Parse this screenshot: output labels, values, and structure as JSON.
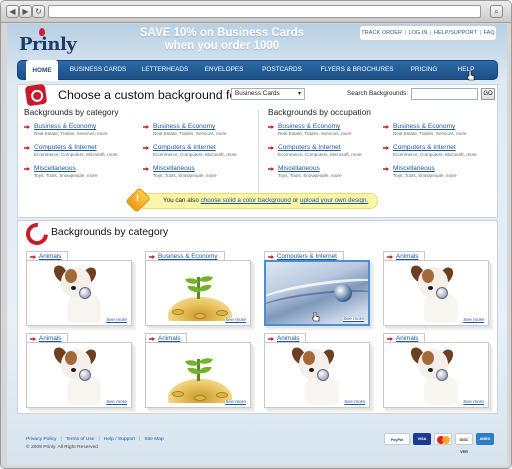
{
  "browser": {
    "back_icon": "back-arrow-icon",
    "forward_icon": "forward-arrow-icon",
    "refresh_icon": "refresh-icon",
    "search_icon": "search-icon"
  },
  "header": {
    "logo_text": "Prinly",
    "promo_line1": "SAVE 10% on Business Cards",
    "promo_line2": "when you order 1000",
    "top_links": [
      "TRACK ORDER",
      "LOG IN",
      "HELP/SUPPORT",
      "FAQ"
    ]
  },
  "nav": {
    "items": [
      "HOME",
      "BUSINESS CARDS",
      "LETTERHEADS",
      "ENVELOPES",
      "POSTCARDS",
      "FLYERS & BROCHURES",
      "PRICING",
      "HELP"
    ],
    "active": "HOME"
  },
  "custom_panel": {
    "title": "Choose a custom background for",
    "select_value": "Business Cards",
    "search_label": "Search Backgrounds:",
    "search_value": "",
    "go_label": "GO",
    "left_heading": "Backgrounds by category",
    "right_heading": "Backgrounds by occupation",
    "left_categories": [
      {
        "label": "Business & Economy",
        "sub": "Real Estate, Trades, Services, more"
      },
      {
        "label": "Business & Economy",
        "sub": "Real Estate, Trades, Services, more"
      },
      {
        "label": "Computers & Internet",
        "sub": "Ecommerce, Computers, Microsoft, more"
      },
      {
        "label": "Computers & Internet",
        "sub": "Ecommerce, Computers, Microsoft, more"
      },
      {
        "label": "Miscellaneous",
        "sub": "Toys, Tools, Snowpeople, more"
      },
      {
        "label": "Miscellaneous",
        "sub": "Toys, Tools, Snowpeople, more"
      }
    ],
    "right_categories": [
      {
        "label": "Business & Economy",
        "sub": "Real Estate, Trades, Services, more"
      },
      {
        "label": "Business & Economy",
        "sub": "Real Estate, Trades, Services, more"
      },
      {
        "label": "Computers & Internet",
        "sub": "Ecommerce, Computers, Microsoft, more"
      },
      {
        "label": "Computers & Internet",
        "sub": "Ecommerce, Computers, Microsoft, more"
      },
      {
        "label": "Miscellaneous",
        "sub": "Toys, Tools, Snowpeople, more"
      },
      {
        "label": "Miscellaneous",
        "sub": "Toys, Tools, Snowpeople, more"
      }
    ],
    "notice_prefix": "You can also",
    "notice_link1": "choose solid a color background",
    "notice_mid": "or",
    "notice_link2": "upload your own design.",
    "notice_icon_text": "i"
  },
  "gallery": {
    "title": "Backgrounds by category",
    "cards": [
      {
        "label": "Animals",
        "image": "dog",
        "see_more": "See more"
      },
      {
        "label": "Business & Economy",
        "image": "coins",
        "see_more": "See more"
      },
      {
        "label": "Computers & Internet",
        "image": "tech",
        "see_more": "See more"
      },
      {
        "label": "Animals",
        "image": "dog",
        "see_more": "See more"
      },
      {
        "label": "Animals",
        "image": "dog",
        "see_more": "See more"
      },
      {
        "label": "Animals",
        "image": "coins",
        "see_more": "See more"
      },
      {
        "label": "Animals",
        "image": "dog",
        "see_more": "See more"
      },
      {
        "label": "Animals",
        "image": "dog",
        "see_more": "See more"
      }
    ]
  },
  "footer": {
    "links": [
      "Privacy Policy",
      "Terms of Use",
      "Help / Support",
      "Site Map"
    ],
    "copyright": "© 2009 Prinly. All Right Reserved",
    "payment_icons": [
      "paypal-icon",
      "visa-icon",
      "mastercard-icon",
      "discover-icon",
      "amex-icon"
    ],
    "paypal_text": "PayPal",
    "visa_text": "VISA",
    "discover_text": "DISC VER",
    "amex_text": "AMEX"
  },
  "colors": {
    "brand_blue": "#1c4f86",
    "accent_red": "#c71a2b",
    "link_blue": "#1e56a0",
    "notice_yellow": "#fbf6a7"
  }
}
